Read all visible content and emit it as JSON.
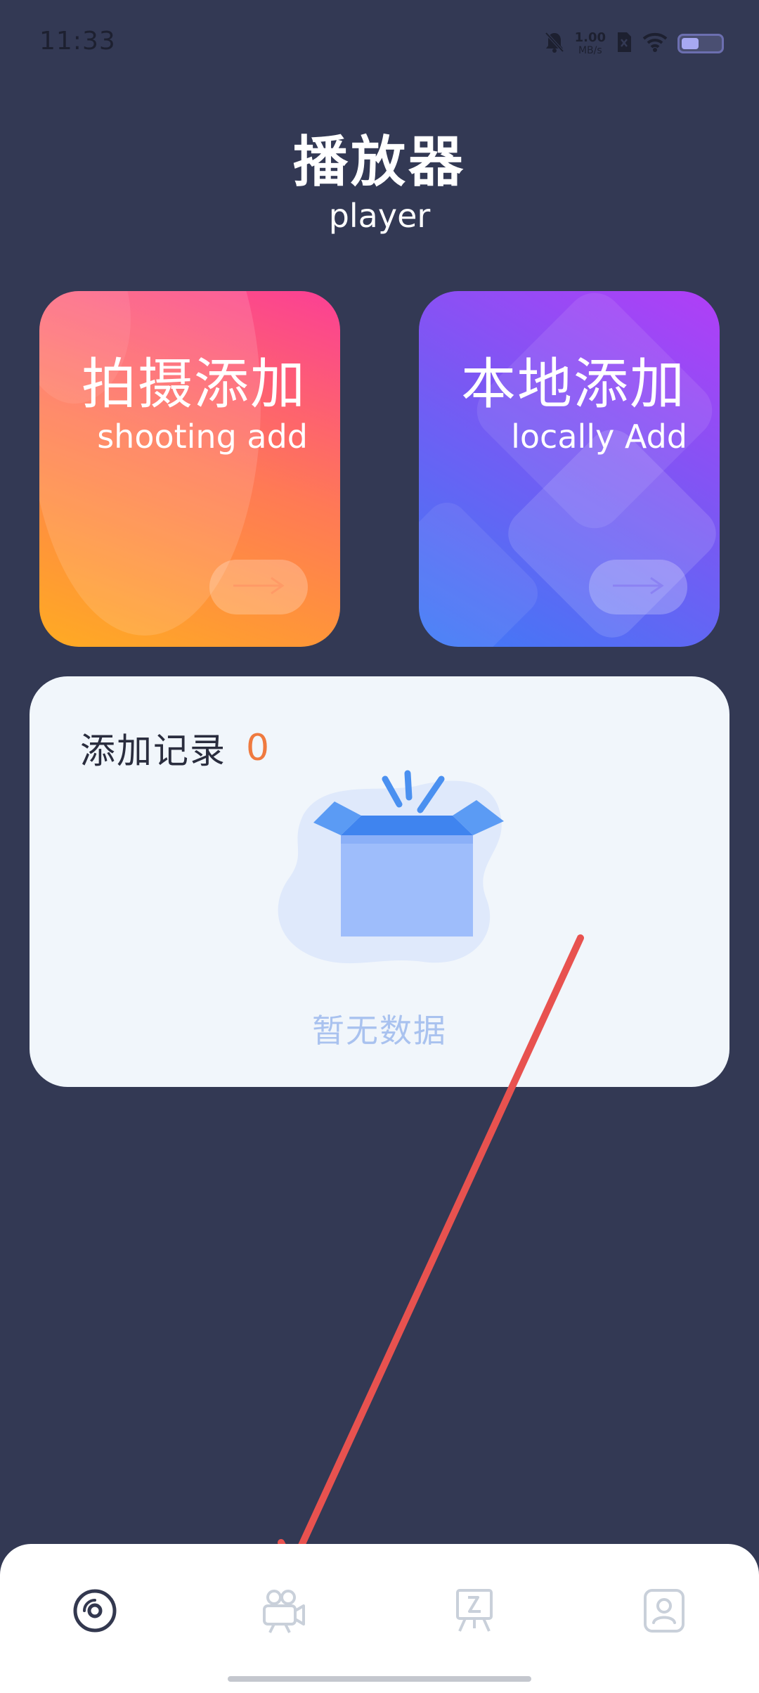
{
  "status_bar": {
    "time": "11:33",
    "net_speed_value": "1.00",
    "net_speed_unit": "MB/s",
    "icons": [
      "mute-icon",
      "sim-icon",
      "wifi-icon",
      "battery-icon"
    ]
  },
  "header": {
    "title": "播放器",
    "subtitle": "player"
  },
  "cards": {
    "shoot": {
      "title": "拍摄添加",
      "subtitle": "shooting add",
      "icon": "arrow-right-icon"
    },
    "local": {
      "title": "本地添加",
      "subtitle": "locally Add",
      "icon": "arrow-right-icon"
    }
  },
  "records": {
    "title": "添加记录",
    "count": "0",
    "empty_text": "暂无数据",
    "empty_icon": "open-box-icon"
  },
  "bottom_nav": {
    "items": [
      {
        "icon": "disc-icon",
        "active": true
      },
      {
        "icon": "video-camera-icon",
        "active": false
      },
      {
        "icon": "easel-icon",
        "active": false
      },
      {
        "icon": "profile-icon",
        "active": false
      }
    ]
  },
  "colors": {
    "background": "#333954",
    "accent_orange": "#ef7a3f",
    "annotation_arrow": "#e8524f",
    "nav_active": "#33384f",
    "nav_inactive": "#c9d0da"
  }
}
